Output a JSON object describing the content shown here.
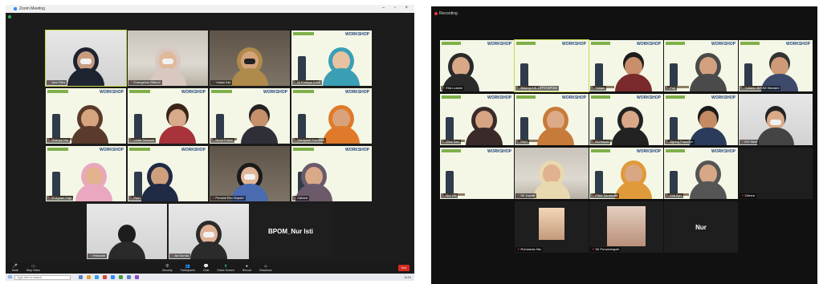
{
  "left_window": {
    "title": "Zoom Meeting",
    "window_controls": "–  ▫  ×",
    "tiles": [
      {
        "name": "Ana Fitria",
        "active": true
      },
      {
        "name": "Evangeline Effendi"
      },
      {
        "name": "Yuliani Aet"
      },
      {
        "name": "El Farlisya Arifin"
      },
      {
        "name": "Dhimya Nia"
      },
      {
        "name": "Linda Siswanti"
      },
      {
        "name": "Nurul Fahmi"
      },
      {
        "name": "Daniyanti Sondakh"
      },
      {
        "name": "El Agnan Fajri"
      },
      {
        "name": "Putri"
      },
      {
        "name": "Purwati Eko Saputri"
      },
      {
        "name": "Zahara"
      },
      {
        "name": "Febriane"
      },
      {
        "name": "Ari Kurnia"
      },
      {
        "name": "BPOM_Nur Isti",
        "big": true
      }
    ],
    "poster_title": "WORKSHOP",
    "toolbar": {
      "items": [
        {
          "label": "Mute",
          "icon": "🎤"
        },
        {
          "label": "Stop Video",
          "icon": "▭"
        },
        {
          "label": "Security",
          "icon": "⛨"
        },
        {
          "label": "Participants",
          "icon": "👥"
        },
        {
          "label": "Chat",
          "icon": "💬"
        },
        {
          "label": "Share Screen",
          "icon": "⬆"
        },
        {
          "label": "Record",
          "icon": "●"
        },
        {
          "label": "Reactions",
          "icon": "☺"
        }
      ],
      "end_label": "End"
    },
    "taskbar": {
      "search_placeholder": "Type here to search",
      "clock": "10:04"
    }
  },
  "right_window": {
    "recording_label": "Recording",
    "tiles": [
      {
        "name": "Ella Lusiani"
      },
      {
        "name": "Bidang KIE-DTPO BPOM",
        "active": true
      },
      {
        "name": "Yuliani"
      },
      {
        "name": "Fuji"
      },
      {
        "name": "Yulianto BPOM Wardani"
      },
      {
        "name": "Dina Sari"
      },
      {
        "name": "Putri"
      },
      {
        "name": "Nurhayati"
      },
      {
        "name": "Agung Prasetyo"
      },
      {
        "name": "Evi Yanti"
      },
      {
        "name": "Nur Siti"
      },
      {
        "name": "Sri Jupiati"
      },
      {
        "name": "Fitria Saraswati"
      },
      {
        "name": "Ima Ayu"
      },
      {
        "name": "Zahara"
      },
      {
        "name": "Rohmania Nia"
      },
      {
        "name": "Sri Purwaningsih"
      },
      {
        "name": "Nur",
        "big": true
      }
    ]
  }
}
